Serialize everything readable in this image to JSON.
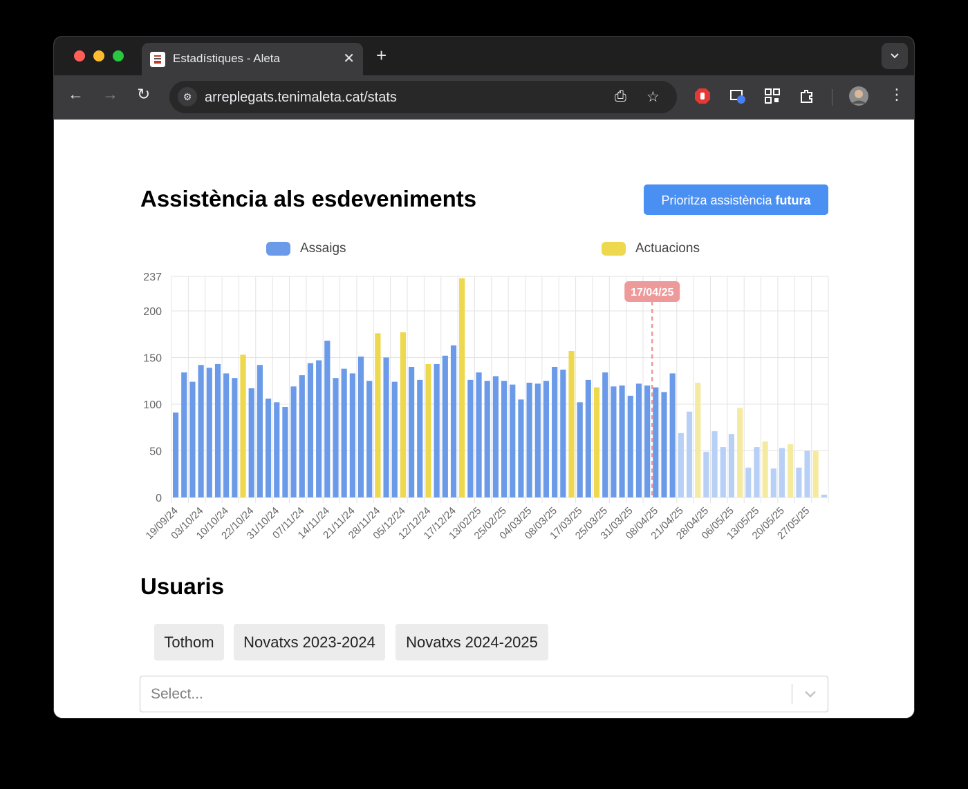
{
  "browser": {
    "tab_title": "Estadístiques - Aleta",
    "url": "arreplegats.tenimaleta.cat/stats"
  },
  "page": {
    "title": "Assistència als esdeveniments",
    "priority_button": {
      "prefix": "Prioritza assistència ",
      "bold": "futura"
    },
    "users_heading": "Usuaris",
    "filters": [
      "Tothom",
      "Novatxs 2023-2024",
      "Novatxs 2024-2025"
    ],
    "select_placeholder": "Select..."
  },
  "colors": {
    "assaigs": "#6b9be8",
    "actuacions": "#eed84e",
    "assaigs_future": "#b8d0f5",
    "actuacions_future": "#f5eba0",
    "today_marker": "#ee9a9a",
    "button": "#4a90f2"
  },
  "chart_data": {
    "type": "bar",
    "title": "",
    "xlabel": "",
    "ylabel": "",
    "ylim": [
      0,
      237
    ],
    "yticks": [
      0,
      50,
      100,
      150,
      200,
      237
    ],
    "grid": true,
    "legend_position": "top",
    "series": [
      {
        "name": "Assaigs",
        "color": "#6b9be8"
      },
      {
        "name": "Actuacions",
        "color": "#eed84e"
      }
    ],
    "today_marker": {
      "label": "17/04/25",
      "after_index": 56
    },
    "x_tick_labels": [
      "19/09/24",
      "03/10/24",
      "10/10/24",
      "22/10/24",
      "31/10/24",
      "07/11/24",
      "14/11/24",
      "21/11/24",
      "28/11/24",
      "05/12/24",
      "12/12/24",
      "17/12/24",
      "13/02/25",
      "25/02/25",
      "04/03/25",
      "08/03/25",
      "17/03/25",
      "25/03/25",
      "31/03/25",
      "08/04/25",
      "21/04/25",
      "28/04/25",
      "06/05/25",
      "13/05/25",
      "20/05/25",
      "27/05/25"
    ],
    "bars": [
      {
        "type": "A",
        "value": 91
      },
      {
        "type": "A",
        "value": 134
      },
      {
        "type": "A",
        "value": 124
      },
      {
        "type": "A",
        "value": 142
      },
      {
        "type": "A",
        "value": 139
      },
      {
        "type": "A",
        "value": 143
      },
      {
        "type": "A",
        "value": 133
      },
      {
        "type": "A",
        "value": 128
      },
      {
        "type": "P",
        "value": 153
      },
      {
        "type": "A",
        "value": 117
      },
      {
        "type": "A",
        "value": 142
      },
      {
        "type": "A",
        "value": 106
      },
      {
        "type": "A",
        "value": 102
      },
      {
        "type": "A",
        "value": 97
      },
      {
        "type": "A",
        "value": 119
      },
      {
        "type": "A",
        "value": 131
      },
      {
        "type": "A",
        "value": 144
      },
      {
        "type": "A",
        "value": 147
      },
      {
        "type": "A",
        "value": 168
      },
      {
        "type": "A",
        "value": 128
      },
      {
        "type": "A",
        "value": 138
      },
      {
        "type": "A",
        "value": 133
      },
      {
        "type": "A",
        "value": 151
      },
      {
        "type": "A",
        "value": 125
      },
      {
        "type": "P",
        "value": 176
      },
      {
        "type": "A",
        "value": 150
      },
      {
        "type": "A",
        "value": 124
      },
      {
        "type": "P",
        "value": 177
      },
      {
        "type": "A",
        "value": 140
      },
      {
        "type": "A",
        "value": 126
      },
      {
        "type": "P",
        "value": 143
      },
      {
        "type": "A",
        "value": 143
      },
      {
        "type": "A",
        "value": 152
      },
      {
        "type": "A",
        "value": 163
      },
      {
        "type": "P",
        "value": 235
      },
      {
        "type": "A",
        "value": 126
      },
      {
        "type": "A",
        "value": 134
      },
      {
        "type": "A",
        "value": 125
      },
      {
        "type": "A",
        "value": 130
      },
      {
        "type": "A",
        "value": 125
      },
      {
        "type": "A",
        "value": 121
      },
      {
        "type": "A",
        "value": 105
      },
      {
        "type": "A",
        "value": 123
      },
      {
        "type": "A",
        "value": 122
      },
      {
        "type": "A",
        "value": 125
      },
      {
        "type": "A",
        "value": 140
      },
      {
        "type": "A",
        "value": 137
      },
      {
        "type": "P",
        "value": 157
      },
      {
        "type": "A",
        "value": 102
      },
      {
        "type": "A",
        "value": 126
      },
      {
        "type": "P",
        "value": 118
      },
      {
        "type": "A",
        "value": 134
      },
      {
        "type": "A",
        "value": 119
      },
      {
        "type": "A",
        "value": 120
      },
      {
        "type": "A",
        "value": 109
      },
      {
        "type": "A",
        "value": 122
      },
      {
        "type": "A",
        "value": 120
      },
      {
        "type": "A",
        "value": 118
      },
      {
        "type": "A",
        "value": 113
      },
      {
        "type": "A",
        "value": 133
      },
      {
        "type": "A",
        "value": 69,
        "future": true
      },
      {
        "type": "A",
        "value": 92,
        "future": true
      },
      {
        "type": "P",
        "value": 123,
        "future": true
      },
      {
        "type": "A",
        "value": 49,
        "future": true
      },
      {
        "type": "A",
        "value": 71,
        "future": true
      },
      {
        "type": "A",
        "value": 54,
        "future": true
      },
      {
        "type": "A",
        "value": 68,
        "future": true
      },
      {
        "type": "P",
        "value": 96,
        "future": true
      },
      {
        "type": "A",
        "value": 32,
        "future": true
      },
      {
        "type": "A",
        "value": 54,
        "future": true
      },
      {
        "type": "P",
        "value": 60,
        "future": true
      },
      {
        "type": "A",
        "value": 31,
        "future": true
      },
      {
        "type": "A",
        "value": 53,
        "future": true
      },
      {
        "type": "P",
        "value": 57,
        "future": true
      },
      {
        "type": "A",
        "value": 32,
        "future": true
      },
      {
        "type": "A",
        "value": 50,
        "future": true
      },
      {
        "type": "P",
        "value": 50,
        "future": true
      },
      {
        "type": "A",
        "value": 3,
        "future": true
      }
    ]
  }
}
